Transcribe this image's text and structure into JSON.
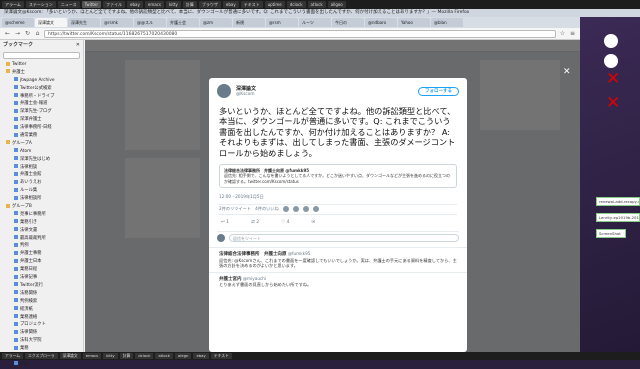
{
  "topbar": {
    "tasks": [
      "アラーム",
      "ステーション",
      "ニュース",
      "Twitter",
      "ファイル",
      "ebay",
      "emacs",
      "kitty",
      "計算",
      "ブラウザ",
      "ebay",
      "テキスト"
    ],
    "right": [
      "uptime",
      "dclock",
      "atlock",
      "allgoo"
    ]
  },
  "window_title": "深澤論文@Kscom: 「多いというか、ほとんど全てですよね。他の訴訟類型と比べて、本当に、ダウンゴールが普通に多いです。Q: これまでこういう書面を出したんですか、何か付け加えることはありますか？」— Mozilla Firefox",
  "tabs": [
    "@scheme",
    "深澤論文",
    "深澤先生",
    "@rsmk",
    "@@スル",
    "弁護士会",
    "@zm",
    "新規",
    "@rsm",
    "ルーツ",
    "今日の",
    "@ndbaro",
    "Yahoo",
    "@blan"
  ],
  "url": "https://twitter.com/Kscom/status/1168267517020430080",
  "sidebar": {
    "title": "ブックマーク",
    "items": [
      "Twitter",
      "弁護士",
      "jtwpage Archive",
      "Twitter公式検索",
      "事務所・ドライブ",
      "弁護士会-報道",
      "深澤先生-ブログ",
      "深澤弁護士",
      "法律事務所-日経",
      "通常業務",
      "グループA",
      "Atom",
      "深澤先生はじめ",
      "法律相談",
      "弁護士会館",
      "あいうえお",
      "ルール集",
      "法律相談所",
      "グループB",
      "見事に事務所",
      "業務引き",
      "法律文書",
      "最高裁裁判所",
      "判例",
      "弁護士事務",
      "弁護士日本",
      "業務日程",
      "法律記事",
      "Twitter流行",
      "法務関係",
      "判例検索",
      "経済紙",
      "業務連絡",
      "プロジェクト",
      "法律関係",
      "法科大学院",
      "業務",
      "相続",
      "登記"
    ]
  },
  "tweet": {
    "name": "深澤論文",
    "handle": "@Kscom",
    "follow": "フォローする",
    "text": "多いというか、ほとんど全てですよね。他の訴訟類型と比べて、本当に、ダウンゴールが普通に多いです。Q: これまでこういう書面を出したんですか、何か付け加えることはありますか？ A: それよりもまずは、出してしまった書面、主張のダメージコントロールから始めましょう。",
    "quote_head": "法律総合法律事務所　弁護士向原 @fumkk95",
    "quote_body": "返信先: 相手側で、こんなを書いようとしてる人ですか。どこか迷いやすい点、ダウンゴールなどが主張を進めるのに役立つのか確認する。twitter.com/Kscom/status",
    "time": "12:00 - 2019年1月5日",
    "stats": "2件のリツイート　4件のいいね",
    "actions": [
      "1",
      "2",
      "4",
      "✉"
    ],
    "reply_placeholder": "返信をツイート",
    "replies": [
      {
        "name": "法律総合法律事務所　弁護士向原",
        "handle": "@fumkk95",
        "text": "返信先: @Kscomさん、これまでの書面を一度確認してもいいでしょうか。実は、弁護士の手元にある資料を精査してから、主張の方針を決めるのがよいかと思います。"
      },
      {
        "name": "弁護士宮内",
        "handle": "@miyauchi",
        "text": "とりあえず書面の見直しから始めたい所ですね。"
      }
    ]
  },
  "desktop_notes": [
    "renewal-add-recopy-unp",
    "Lenrity-ep2019b-2019",
    "ScreenShot"
  ],
  "taskbar": [
    "アラーム",
    "エクスプローラ",
    "深澤論文",
    "emacs",
    "kitty",
    "計算",
    "dclock",
    "atlock",
    "olegn",
    "ebay",
    "テキスト"
  ]
}
